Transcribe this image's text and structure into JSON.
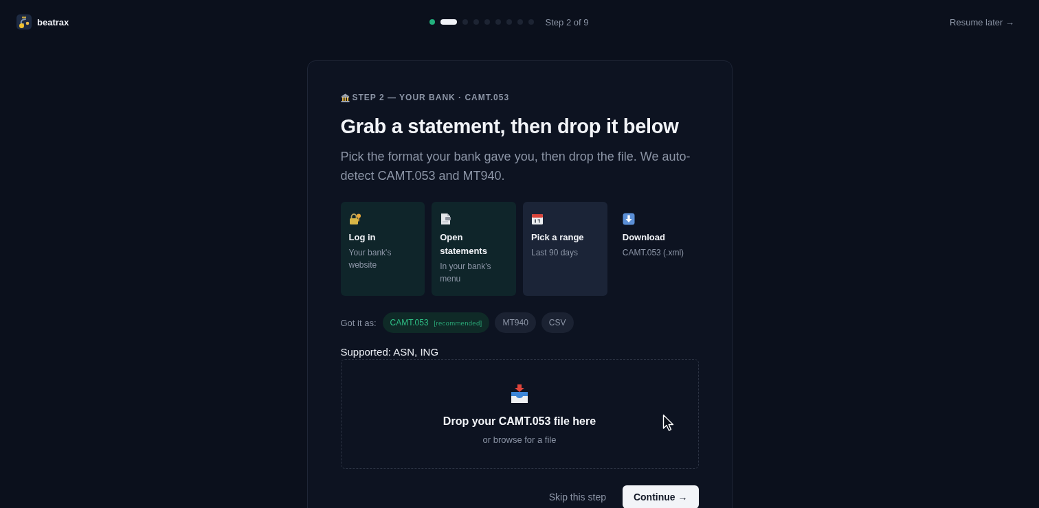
{
  "header": {
    "brand": "beatrax",
    "progress": {
      "steps": [
        {
          "done": true,
          "selected": false
        },
        {
          "done": false,
          "selected": true
        },
        {
          "done": false,
          "selected": false
        },
        {
          "done": false,
          "selected": false
        },
        {
          "done": false,
          "selected": false
        },
        {
          "done": false,
          "selected": false
        },
        {
          "done": false,
          "selected": false
        },
        {
          "done": false,
          "selected": false
        },
        {
          "done": false,
          "selected": false
        }
      ],
      "label": "Step 2 of 9"
    },
    "resume_link": "Resume later →"
  },
  "card": {
    "eyebrow": "STEP 2 — YOUR BANK · CAMT.053",
    "title": "Grab a statement, then drop it below",
    "subtitle": "Pick the format your bank gave you, then drop the file. We auto-detect CAMT.053 and MT940.",
    "steps": [
      {
        "title": "Log in",
        "detail": "Your bank's website",
        "done": true,
        "selected": false
      },
      {
        "title": "Open statements",
        "detail": "In your bank's menu",
        "done": true,
        "selected": false
      },
      {
        "title": "Pick a range",
        "detail": "Last 90 days",
        "done": false,
        "selected": true
      },
      {
        "title": "Download",
        "detail": "CAMT.053 (.xml)",
        "done": false,
        "selected": false
      }
    ],
    "format_picker": {
      "label": "Got it as:",
      "options": [
        {
          "label": "CAMT.053",
          "badge": "[recommended]",
          "selected": true
        },
        {
          "label": "MT940",
          "selected": false
        },
        {
          "label": "CSV",
          "selected": false
        }
      ]
    },
    "supported": "Supported: ASN, ING",
    "dropzone": {
      "title": "Drop your CAMT.053 file here",
      "hint": "or browse for a file"
    },
    "actions": {
      "skip": "Skip this step",
      "continue": "Continue →"
    }
  }
}
